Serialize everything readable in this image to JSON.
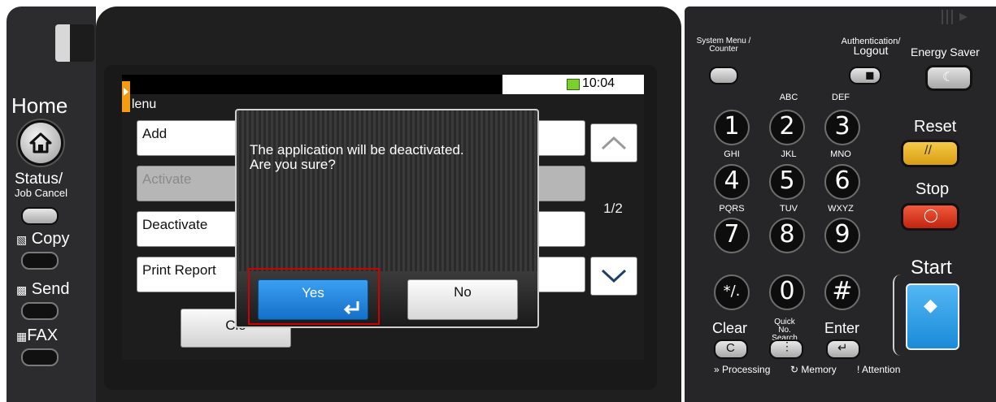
{
  "screen": {
    "clock": "10:04",
    "menu_title": "lenu",
    "items": [
      {
        "label": "Add",
        "enabled": true
      },
      {
        "label": "Activate",
        "enabled": false
      },
      {
        "label": "Deactivate",
        "enabled": true
      },
      {
        "label": "Print Report",
        "enabled": true
      }
    ],
    "page_indicator": "1/2",
    "close_label": "Clo"
  },
  "dialog": {
    "line1": "The application will be deactivated.",
    "line2": "Are you sure?",
    "yes_label": "Yes",
    "no_label": "No"
  },
  "left_panel": {
    "home": "Home",
    "status_top": "Status/",
    "status_bottom": "Job Cancel",
    "copy": "Copy",
    "send": "Send",
    "fax": "FAX"
  },
  "right_panel": {
    "system_menu_1": "System Menu /",
    "system_menu_2": "Counter",
    "auth_1": "Authentication/",
    "auth_2": "Logout",
    "energy_saver": "Energy Saver",
    "reset": "Reset",
    "stop": "Stop",
    "start": "Start",
    "clear": "Clear",
    "enter": "Enter",
    "quick_1": "Quick No.",
    "quick_2": "Search",
    "keys": [
      "1",
      "2",
      "3",
      "4",
      "5",
      "6",
      "7",
      "8",
      "9",
      "*/.",
      "0",
      "#"
    ],
    "sublabels": {
      "k2": "ABC",
      "k3": "DEF",
      "k4": "GHI",
      "k5": "JKL",
      "k6": "MNO",
      "k7": "PQRS",
      "k8": "TUV",
      "k9": "WXYZ"
    },
    "led_processing": "Processing",
    "led_memory": "Memory",
    "led_attention": "Attention"
  },
  "colors": {
    "accent_blue": "#1f86e0",
    "reset_yellow": "#e8b52a",
    "stop_red": "#e0452a",
    "highlight_red": "#d10000",
    "clock_green": "#7ccd2e"
  }
}
